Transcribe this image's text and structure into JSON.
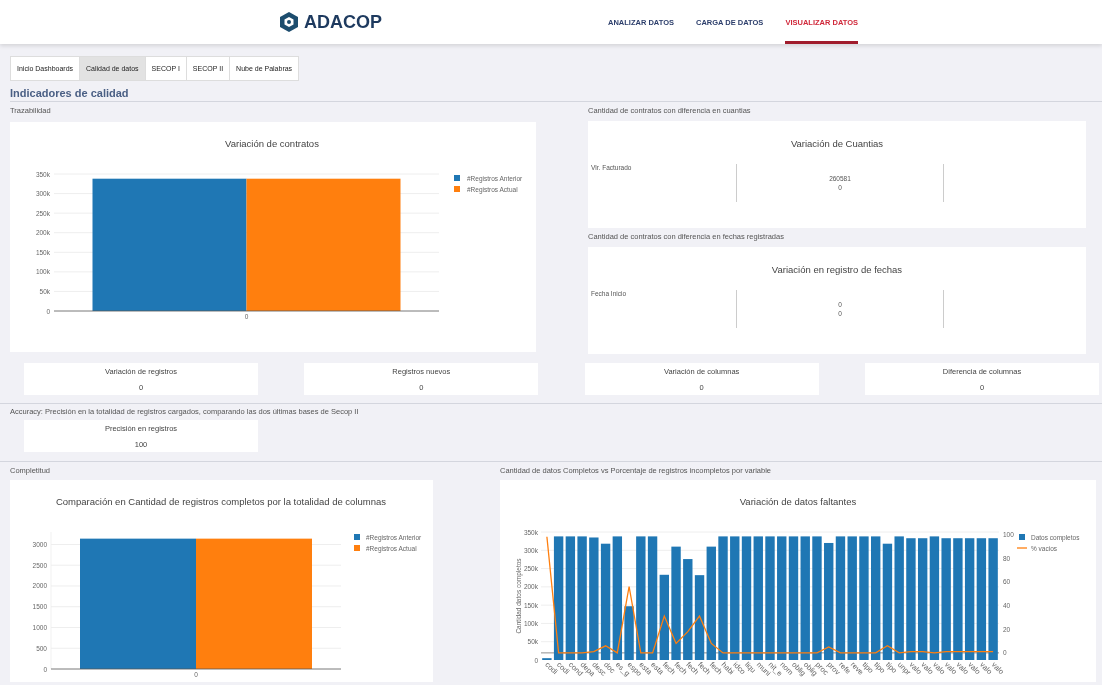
{
  "header": {
    "logo": "ADACOP",
    "nav": [
      {
        "label": "ANALIZAR DATOS",
        "selected": false
      },
      {
        "label": "CARGA DE DATOS",
        "selected": false
      },
      {
        "label": "VISUALIZAR DATOS",
        "selected": true
      }
    ]
  },
  "tabs": [
    {
      "label": "Inicio Dashboards",
      "selected": false
    },
    {
      "label": "Calidad de datos",
      "selected": true
    },
    {
      "label": "SECOP I",
      "selected": false
    },
    {
      "label": "SECOP II",
      "selected": false
    },
    {
      "label": "Nube de Palabras",
      "selected": false
    }
  ],
  "section_title": "Indicadores de calidad",
  "trazabilidad": {
    "label": "Trazabilidad",
    "chart_data": {
      "type": "bar",
      "title": "Variación de contratos",
      "categories": [
        "0"
      ],
      "grid": true,
      "legend": true,
      "series": [
        {
          "name": "#Registros Anterior",
          "color": "#1f77b4",
          "values": [
            338000
          ]
        },
        {
          "name": "#Registros Actual",
          "color": "#ff7f0e",
          "values": [
            338000
          ]
        }
      ],
      "ylim": [
        0,
        350000
      ],
      "yticks": [
        {
          "value": 0,
          "label": "0"
        },
        {
          "value": 50000,
          "label": "50k"
        },
        {
          "value": 100000,
          "label": "100k"
        },
        {
          "value": 150000,
          "label": "150k"
        },
        {
          "value": 200000,
          "label": "200k"
        },
        {
          "value": 250000,
          "label": "250k"
        },
        {
          "value": 300000,
          "label": "300k"
        },
        {
          "value": 350000,
          "label": "350k"
        }
      ]
    }
  },
  "cuantias": {
    "label": "Cantidad de contratos con diferencia en cuantias",
    "title": "Variación de Cuantias",
    "row_label": "Vlr. Facturado",
    "values": [
      "260581",
      "0"
    ]
  },
  "fechas": {
    "label": "Cantidad de contratos con diferencia en fechas registradas",
    "title": "Variación en registro de fechas",
    "row_label": "Fecha Inicio",
    "values": [
      "0",
      "0"
    ]
  },
  "indicators": [
    {
      "title": "Variación de registros",
      "value": "0"
    },
    {
      "title": "Registros nuevos",
      "value": "0"
    },
    {
      "title": "Variación de columnas",
      "value": "0"
    },
    {
      "title": "Diferencia de columnas",
      "value": "0"
    }
  ],
  "accuracy": {
    "label": "Accuracy: Precisión en la totalidad de registros cargados, comparando las dos últimas bases de Secop II",
    "cards": [
      {
        "title": "Precisión en registros",
        "value": "100"
      }
    ]
  },
  "completitud": {
    "label": "Completitud",
    "chart_data": {
      "type": "bar",
      "title": "Comparación en Cantidad de registros completos por la totalidad de columnas",
      "categories": [
        "0"
      ],
      "grid": true,
      "legend": true,
      "series": [
        {
          "name": "#Registros Anterior",
          "color": "#1f77b4",
          "values": [
            3140
          ]
        },
        {
          "name": "#Registros Actual",
          "color": "#ff7f0e",
          "values": [
            3140
          ]
        }
      ],
      "ylim": [
        0,
        3300
      ],
      "yticks": [
        0,
        500,
        1000,
        1500,
        2000,
        2500,
        3000
      ]
    }
  },
  "faltantes": {
    "label": "Cantidad de datos Completos vs Porcentaje de registros incompletos por variable",
    "chart_data": {
      "type": "bar",
      "title": "Variación de datos faltantes",
      "ylabel": "Cantidad datos completos",
      "grid": true,
      "legend": true,
      "categories": [
        "codi",
        "codi",
        "cond",
        "depa",
        "desc",
        "doc",
        "es_g",
        "espo",
        "esta",
        "esta",
        "fech",
        "fech",
        "fech",
        "fech",
        "fech",
        "habi",
        "idco",
        "liqu",
        "muni",
        "nit_e",
        "nom",
        "oblig",
        "oblig",
        "proc",
        "prov",
        "refe",
        "reve",
        "tipo",
        "tipo",
        "tipo",
        "unpr",
        "valo",
        "valo",
        "valo",
        "valo",
        "valo",
        "valo",
        "valo",
        "valo"
      ],
      "series": [
        {
          "name": "Datos completos",
          "color": "#1f77b4",
          "type": "bar",
          "values": [
            5000,
            338000,
            338000,
            338000,
            335000,
            318000,
            338000,
            147000,
            338000,
            338000,
            233000,
            310000,
            276000,
            232000,
            310000,
            338000,
            338000,
            338000,
            338000,
            338000,
            338000,
            338000,
            338000,
            338000,
            320000,
            338000,
            338000,
            338000,
            338000,
            318000,
            338000,
            333000,
            333000,
            338000,
            333000,
            333000,
            333000,
            333000,
            333000
          ]
        },
        {
          "name": "% vacios",
          "color": "#ff7f0e",
          "type": "line",
          "axis": "y2",
          "values": [
            98,
            0,
            0,
            0,
            1,
            6,
            0,
            56,
            0,
            0,
            31,
            8,
            18,
            31,
            8,
            0,
            0,
            0,
            0,
            0,
            0,
            0,
            0,
            0,
            5,
            0,
            0,
            0,
            0,
            6,
            0,
            1,
            1,
            0,
            1,
            1,
            1,
            1,
            1
          ]
        }
      ],
      "ylim": [
        0,
        350000
      ],
      "yticks": [
        {
          "value": 0,
          "label": "0"
        },
        {
          "value": 50000,
          "label": "50k"
        },
        {
          "value": 100000,
          "label": "100k"
        },
        {
          "value": 150000,
          "label": "150k"
        },
        {
          "value": 200000,
          "label": "200k"
        },
        {
          "value": 250000,
          "label": "250k"
        },
        {
          "value": 300000,
          "label": "300k"
        },
        {
          "value": 350000,
          "label": "350k"
        }
      ],
      "y2lim": [
        -6,
        102
      ],
      "y2ticks": [
        0,
        20,
        40,
        60,
        80,
        100
      ]
    }
  }
}
